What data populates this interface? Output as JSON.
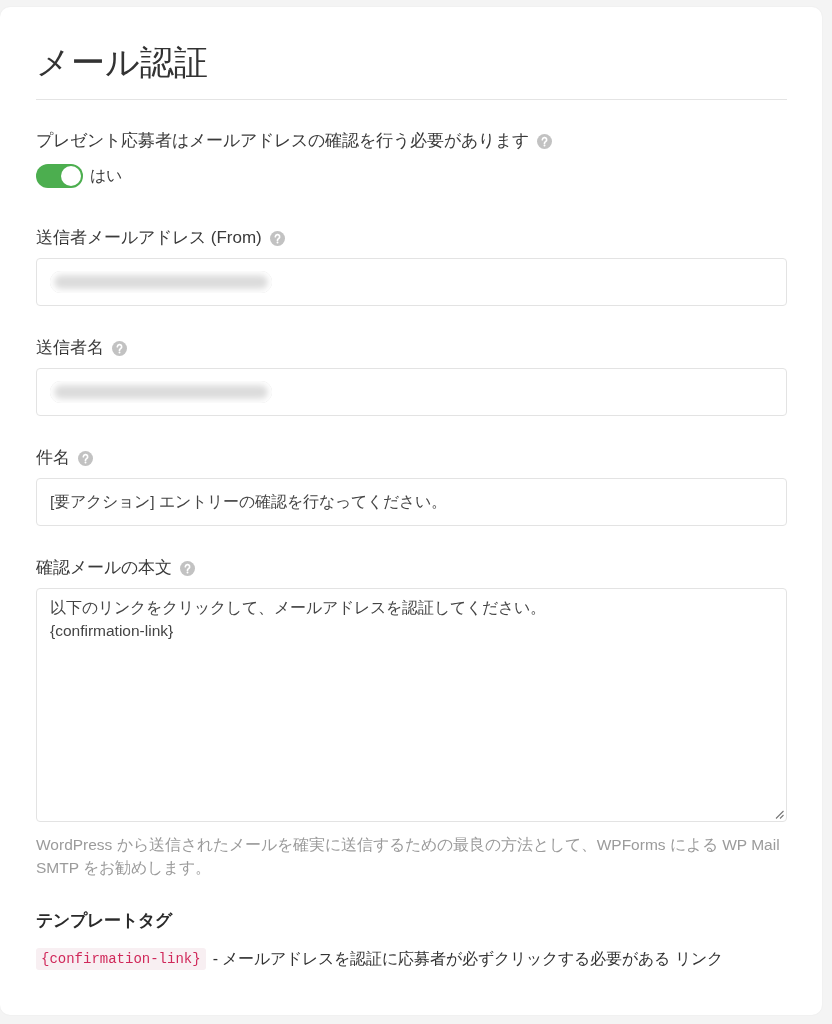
{
  "title": "メール認証",
  "fields": [
    {
      "kind": "toggle",
      "label": "プレゼント応募者はメールアドレスの確認を行う必要があります",
      "help": true,
      "on": true,
      "state_label": "はい"
    },
    {
      "kind": "input",
      "label": "送信者メールアドレス (From)",
      "help": true,
      "blurred": true
    },
    {
      "kind": "input",
      "label": "送信者名",
      "help": true,
      "blurred": true
    },
    {
      "kind": "input",
      "label": "件名",
      "help": true,
      "value": "[要アクション] エントリーの確認を行なってください。"
    },
    {
      "kind": "textarea",
      "label": "確認メールの本文",
      "help": true,
      "value": "以下のリンクをクリックして、メールアドレスを認証してください。\n{confirmation-link}",
      "note": "WordPress から送信されたメールを確実に送信するための最良の方法として、WPForms による WP Mail SMTP をお勧めします。"
    }
  ],
  "template_tags": {
    "heading": "テンプレートタグ",
    "items": [
      {
        "tag": "{confirmation-link}",
        "description": "- メールアドレスを認証に応募者が必ずクリックする必要がある リンク"
      }
    ]
  }
}
